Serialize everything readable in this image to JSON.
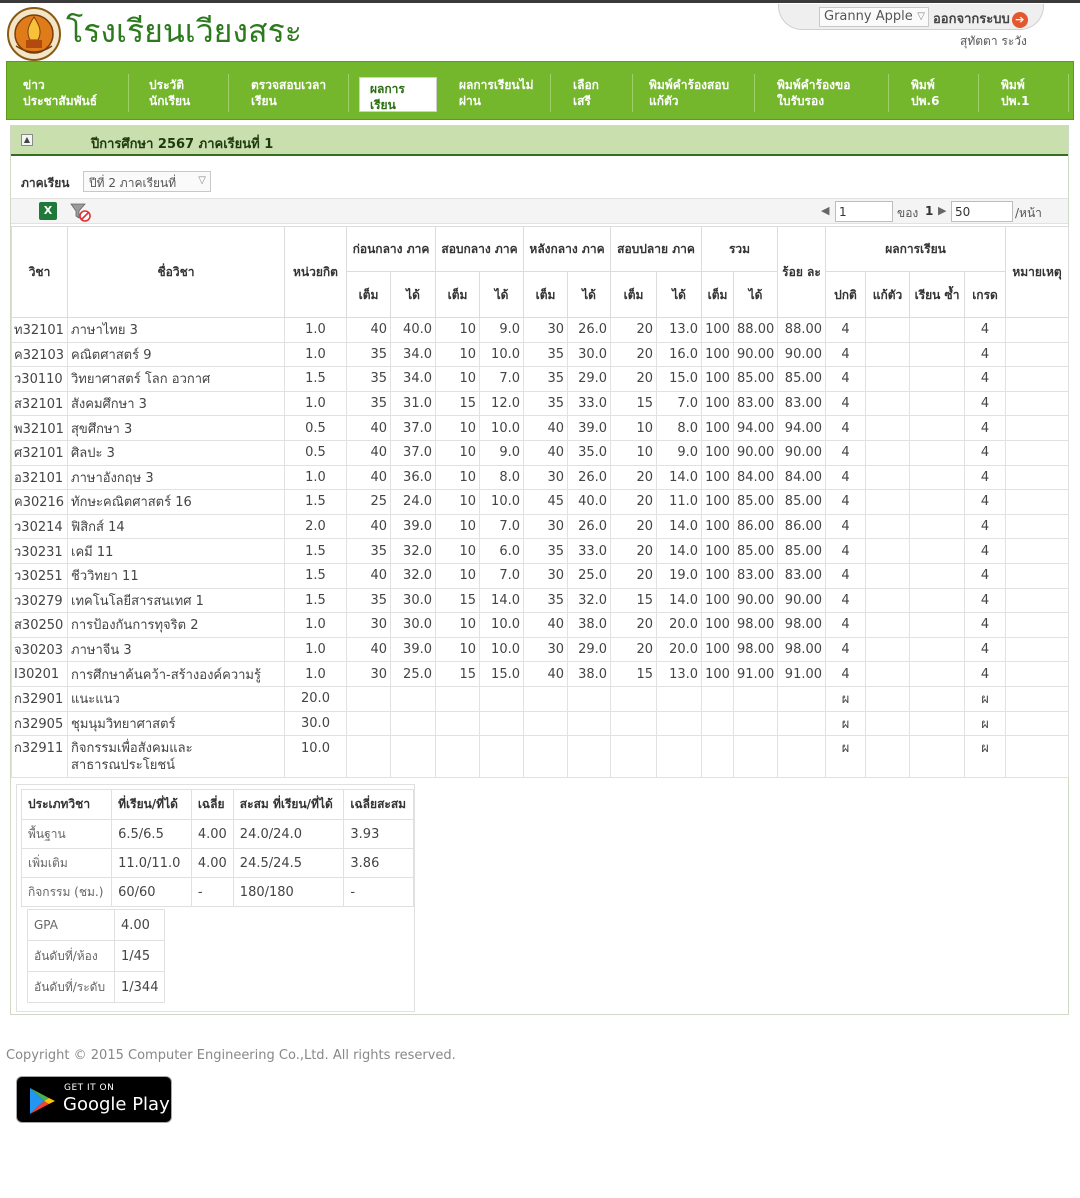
{
  "header": {
    "school_name": "โรงเรียนเวียงสระ",
    "user_select": "Granny Apple",
    "logout_label": "ออกจากระบบ",
    "user_name": "สุทัตตา ระวัง"
  },
  "nav": [
    {
      "line1": "ข่าว",
      "line2": "ประชาสัมพันธ์"
    },
    {
      "line1": "ประวัติ",
      "line2": "นักเรียน"
    },
    {
      "line1": "ตรวจสอบเวลา",
      "line2": "เรียน"
    },
    {
      "line1": "ผลการ",
      "line2": "เรียน"
    },
    {
      "line1": "ผลการเรียนไม่",
      "line2": "ผ่าน"
    },
    {
      "line1": "เลือก",
      "line2": "เสรี"
    },
    {
      "line1": "พิมพ์คำร้องสอบ",
      "line2": "แก้ตัว"
    },
    {
      "line1": "พิมพ์คำร้องขอ",
      "line2": "ใบรับรอง"
    },
    {
      "line1": "พิมพ์",
      "line2": "ปพ.6"
    },
    {
      "line1": "พิมพ์",
      "line2": "ปพ.1"
    }
  ],
  "panel": {
    "title": "ปีการศึกษา 2567 ภาคเรียนที่ 1",
    "semester_label": "ภาคเรียน",
    "semester_value": "ปีที่ 2 ภาคเรียนที่"
  },
  "pager": {
    "page": "1",
    "of_label": "ของ",
    "total_pages": "1",
    "per_page": "50",
    "per_page_label": "/หน้า"
  },
  "table": {
    "headers": {
      "subject": "วิชา",
      "name": "ชื่อวิชา",
      "credit": "หน่วยกิต",
      "g1": "ก่อนกลาง ภาค",
      "g2": "สอบกลาง ภาค",
      "g3": "หลังกลาง ภาค",
      "g4": "สอบปลาย ภาค",
      "total": "รวม",
      "percent": "ร้อย ละ",
      "result": "ผลการเรียน",
      "remark": "หมายเหตุ",
      "full": "เต็ม",
      "got": "ได้",
      "normal": "ปกติ",
      "fix": "แก้ตัว",
      "repeat": "เรียน ซ้ำ",
      "grade": "เกรด"
    },
    "rows": [
      [
        "ท32101",
        "ภาษาไทย 3",
        "1.0",
        "40",
        "40.0",
        "10",
        "9.0",
        "30",
        "26.0",
        "20",
        "13.0",
        "100",
        "88.00",
        "88.00",
        "4",
        "",
        "",
        "4",
        ""
      ],
      [
        "ค32103",
        "คณิตศาสตร์ 9",
        "1.0",
        "35",
        "34.0",
        "10",
        "10.0",
        "35",
        "30.0",
        "20",
        "16.0",
        "100",
        "90.00",
        "90.00",
        "4",
        "",
        "",
        "4",
        ""
      ],
      [
        "ว30110",
        "วิทยาศาสตร์ โลก อวกาศ",
        "1.5",
        "35",
        "34.0",
        "10",
        "7.0",
        "35",
        "29.0",
        "20",
        "15.0",
        "100",
        "85.00",
        "85.00",
        "4",
        "",
        "",
        "4",
        ""
      ],
      [
        "ส32101",
        "สังคมศึกษา 3",
        "1.0",
        "35",
        "31.0",
        "15",
        "12.0",
        "35",
        "33.0",
        "15",
        "7.0",
        "100",
        "83.00",
        "83.00",
        "4",
        "",
        "",
        "4",
        ""
      ],
      [
        "พ32101",
        "สุขศึกษา 3",
        "0.5",
        "40",
        "37.0",
        "10",
        "10.0",
        "40",
        "39.0",
        "10",
        "8.0",
        "100",
        "94.00",
        "94.00",
        "4",
        "",
        "",
        "4",
        ""
      ],
      [
        "ศ32101",
        "ศิลปะ 3",
        "0.5",
        "40",
        "37.0",
        "10",
        "9.0",
        "40",
        "35.0",
        "10",
        "9.0",
        "100",
        "90.00",
        "90.00",
        "4",
        "",
        "",
        "4",
        ""
      ],
      [
        "อ32101",
        "ภาษาอังกฤษ 3",
        "1.0",
        "40",
        "36.0",
        "10",
        "8.0",
        "30",
        "26.0",
        "20",
        "14.0",
        "100",
        "84.00",
        "84.00",
        "4",
        "",
        "",
        "4",
        ""
      ],
      [
        "ค30216",
        "ทักษะคณิตศาสตร์ 16",
        "1.5",
        "25",
        "24.0",
        "10",
        "10.0",
        "45",
        "40.0",
        "20",
        "11.0",
        "100",
        "85.00",
        "85.00",
        "4",
        "",
        "",
        "4",
        ""
      ],
      [
        "ว30214",
        "ฟิสิกส์ 14",
        "2.0",
        "40",
        "39.0",
        "10",
        "7.0",
        "30",
        "26.0",
        "20",
        "14.0",
        "100",
        "86.00",
        "86.00",
        "4",
        "",
        "",
        "4",
        ""
      ],
      [
        "ว30231",
        "เคมี 11",
        "1.5",
        "35",
        "32.0",
        "10",
        "6.0",
        "35",
        "33.0",
        "20",
        "14.0",
        "100",
        "85.00",
        "85.00",
        "4",
        "",
        "",
        "4",
        ""
      ],
      [
        "ว30251",
        "ชีววิทยา 11",
        "1.5",
        "40",
        "32.0",
        "10",
        "7.0",
        "30",
        "25.0",
        "20",
        "19.0",
        "100",
        "83.00",
        "83.00",
        "4",
        "",
        "",
        "4",
        ""
      ],
      [
        "ว30279",
        "เทคโนโลยีสารสนเทศ 1",
        "1.5",
        "35",
        "30.0",
        "15",
        "14.0",
        "35",
        "32.0",
        "15",
        "14.0",
        "100",
        "90.00",
        "90.00",
        "4",
        "",
        "",
        "4",
        ""
      ],
      [
        "ส30250",
        "การป้องกันการทุจริต 2",
        "1.0",
        "30",
        "30.0",
        "10",
        "10.0",
        "40",
        "38.0",
        "20",
        "20.0",
        "100",
        "98.00",
        "98.00",
        "4",
        "",
        "",
        "4",
        ""
      ],
      [
        "จ30203",
        "ภาษาจีน 3",
        "1.0",
        "40",
        "39.0",
        "10",
        "10.0",
        "30",
        "29.0",
        "20",
        "20.0",
        "100",
        "98.00",
        "98.00",
        "4",
        "",
        "",
        "4",
        ""
      ],
      [
        "I30201",
        "การศึกษาค้นคว้า-สร้างองค์ความรู้",
        "1.0",
        "30",
        "25.0",
        "15",
        "15.0",
        "40",
        "38.0",
        "15",
        "13.0",
        "100",
        "91.00",
        "91.00",
        "4",
        "",
        "",
        "4",
        ""
      ],
      [
        "ก32901",
        "แนะแนว",
        "20.0",
        "",
        "",
        "",
        "",
        "",
        "",
        "",
        "",
        "",
        "",
        "",
        "ผ",
        "",
        "",
        "ผ",
        ""
      ],
      [
        "ก32905",
        "ชุมนุมวิทยาศาสตร์",
        "30.0",
        "",
        "",
        "",
        "",
        "",
        "",
        "",
        "",
        "",
        "",
        "",
        "ผ",
        "",
        "",
        "ผ",
        ""
      ],
      [
        "ก32911",
        "กิจกรรมเพื่อสังคมและสาธารณประโยชน์",
        "10.0",
        "",
        "",
        "",
        "",
        "",
        "",
        "",
        "",
        "",
        "",
        "",
        "ผ",
        "",
        "",
        "ผ",
        ""
      ]
    ]
  },
  "summary": {
    "headers": [
      "ประเภทวิชา",
      "ที่เรียน/ที่ได้",
      "เฉลี่ย",
      "สะสม ที่เรียน/ที่ได้",
      "เฉลี่ยสะสม"
    ],
    "rows": [
      [
        "พื้นฐาน",
        "6.5/6.5",
        "4.00",
        "24.0/24.0",
        "3.93"
      ],
      [
        "เพิ่มเติม",
        "11.0/11.0",
        "4.00",
        "24.5/24.5",
        "3.86"
      ],
      [
        "กิจกรรม (ชม.)",
        "60/60",
        "-",
        "180/180",
        "-"
      ]
    ],
    "gpa": [
      [
        "GPA",
        "4.00"
      ],
      [
        "อันดับที่/ห้อง",
        "1/45"
      ],
      [
        "อันดับที่/ระดับ",
        "1/344"
      ]
    ]
  },
  "footer": {
    "copyright": "Copyright © 2015 Computer Engineering Co.,Ltd. All rights reserved.",
    "badge_small": "GET IT ON",
    "badge_big": "Google Play"
  },
  "colors": {
    "nav_green": "#74b72c",
    "title_bar": "#c9dfae",
    "title_border": "#356e1f",
    "brand_text": "#2c7a1d"
  }
}
